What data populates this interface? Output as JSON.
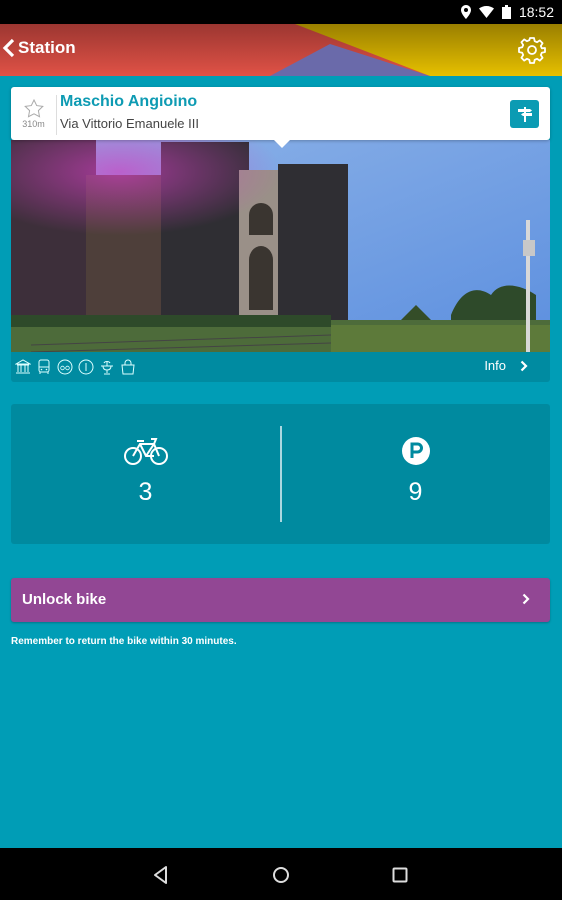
{
  "status_bar": {
    "time": "18:52",
    "icons": [
      "location-icon",
      "wifi-icon",
      "battery-icon"
    ]
  },
  "app_bar": {
    "back_label": "Station",
    "settings_icon": "gear-icon",
    "colors": {
      "red": "#d9473f",
      "purple": "#6a6aaa",
      "yellow": "#d4b000"
    }
  },
  "station": {
    "name": "Maschio Angioino",
    "address": "Via Vittorio Emanuele III",
    "distance": "310m",
    "favorite": false,
    "photo_alt": "Castel Nuovo (Maschio Angioino) castle",
    "amenities": [
      "museum-icon",
      "bus-icon",
      "bike-share-icon",
      "info-icon",
      "fountain-icon",
      "shopping-bag-icon"
    ],
    "info_label": "Info"
  },
  "availability": {
    "bikes": "3",
    "parking": "9",
    "parking_letter": "P"
  },
  "unlock": {
    "label": "Unlock bike"
  },
  "notice": "Remember to return the bike within 30 minutes.",
  "colors": {
    "background": "#009db6",
    "panel": "#008a9f",
    "accent": "#0e9bb3",
    "unlock": "#924794"
  }
}
